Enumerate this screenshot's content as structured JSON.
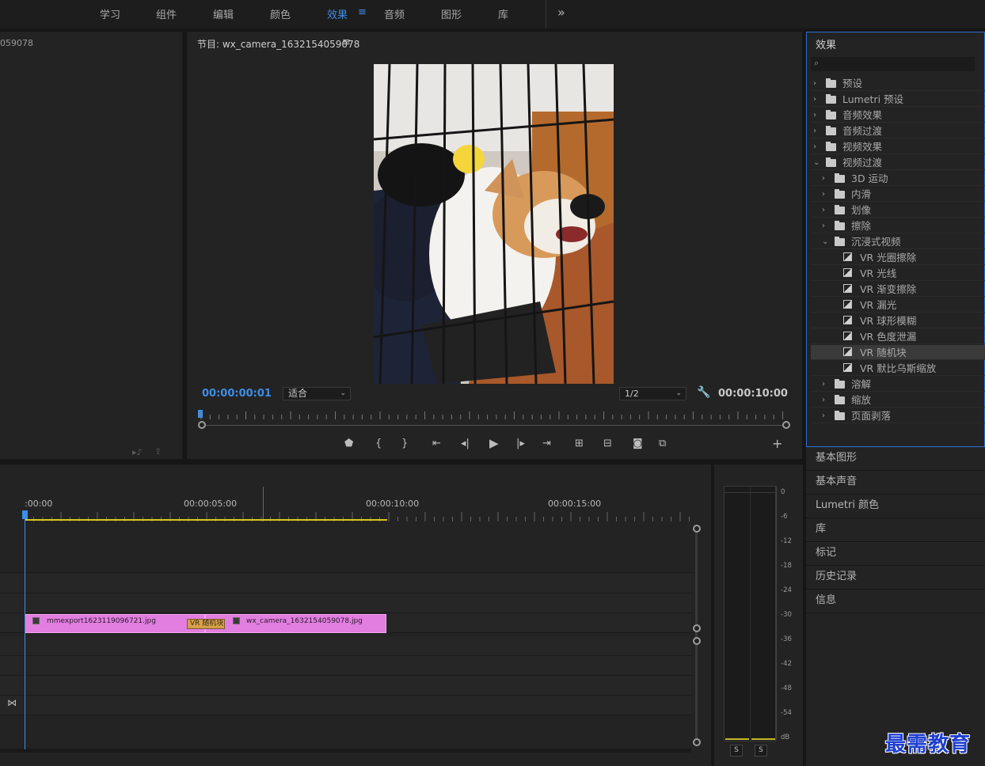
{
  "workspaces": {
    "items": [
      "学习",
      "组件",
      "编辑",
      "颜色",
      "效果",
      "音频",
      "图形",
      "库"
    ],
    "active": "效果",
    "menu_icon": "hamburger-icon",
    "overflow_icon": "double-chevron-right-icon",
    "overflow_glyph": "»"
  },
  "source_panel": {
    "title": "059078"
  },
  "program": {
    "title": "节目: wx_camera_1632154059078",
    "menu_glyph": "≡",
    "current_tc": "00:00:00:01",
    "fit_value": "适合",
    "resolution_value": "1/2",
    "duration_tc": "00:00:10:00",
    "add_glyph": "+"
  },
  "effects": {
    "title": "效果",
    "search_placeholder": "",
    "tree": [
      {
        "label": "预设",
        "kind": "bin-preset",
        "depth": 0,
        "expanded": false
      },
      {
        "label": "Lumetri 预设",
        "kind": "bin-preset",
        "depth": 0,
        "expanded": false
      },
      {
        "label": "音频效果",
        "kind": "folder",
        "depth": 0,
        "expanded": false
      },
      {
        "label": "音频过渡",
        "kind": "folder",
        "depth": 0,
        "expanded": false
      },
      {
        "label": "视频效果",
        "kind": "folder",
        "depth": 0,
        "expanded": false
      },
      {
        "label": "视频过渡",
        "kind": "folder",
        "depth": 0,
        "expanded": true
      },
      {
        "label": "3D 运动",
        "kind": "folder",
        "depth": 1,
        "expanded": false
      },
      {
        "label": "内滑",
        "kind": "folder",
        "depth": 1,
        "expanded": false
      },
      {
        "label": "划像",
        "kind": "folder",
        "depth": 1,
        "expanded": false
      },
      {
        "label": "擦除",
        "kind": "folder",
        "depth": 1,
        "expanded": false
      },
      {
        "label": "沉浸式视频",
        "kind": "folder",
        "depth": 1,
        "expanded": true
      },
      {
        "label": "VR 光圈擦除",
        "kind": "effect",
        "depth": 2
      },
      {
        "label": "VR 光线",
        "kind": "effect",
        "depth": 2
      },
      {
        "label": "VR 渐变擦除",
        "kind": "effect",
        "depth": 2
      },
      {
        "label": "VR 漏光",
        "kind": "effect",
        "depth": 2
      },
      {
        "label": "VR 球形模糊",
        "kind": "effect",
        "depth": 2
      },
      {
        "label": "VR 色度泄漏",
        "kind": "effect",
        "depth": 2
      },
      {
        "label": "VR 随机块",
        "kind": "effect",
        "depth": 2,
        "selected": true
      },
      {
        "label": "VR 默比乌斯缩放",
        "kind": "effect",
        "depth": 2
      },
      {
        "label": "溶解",
        "kind": "folder",
        "depth": 1,
        "expanded": false
      },
      {
        "label": "缩放",
        "kind": "folder",
        "depth": 1,
        "expanded": false
      },
      {
        "label": "页面剥落",
        "kind": "folder",
        "depth": 1,
        "expanded": false
      }
    ]
  },
  "side_panels": [
    "基本图形",
    "基本声音",
    "Lumetri 颜色",
    "库",
    "标记",
    "历史记录",
    "信息"
  ],
  "timeline": {
    "ruler_labels": [
      ":00:00",
      "00:00:05:00",
      "00:00:10:00",
      "00:00:15:00"
    ],
    "clips": [
      {
        "name": "mmexport1623119096721.jpg",
        "color": "#e27ee0"
      },
      {
        "name": "wx_camera_1632154059078.jpg",
        "color": "#e27ee0"
      }
    ],
    "transition_label": "VR 随机块"
  },
  "audio_meter": {
    "db_labels": [
      "0",
      "-6",
      "-12",
      "-18",
      "-24",
      "-30",
      "-36",
      "-42",
      "-48",
      "-54",
      "dB"
    ],
    "solo_labels": [
      "S",
      "S"
    ]
  },
  "watermark": "最需教育",
  "colors": {
    "accent": "#3d8ee6",
    "clip": "#e27ee0",
    "work_area": "#d8c61e",
    "panel_focus": "#2c6fd6"
  }
}
